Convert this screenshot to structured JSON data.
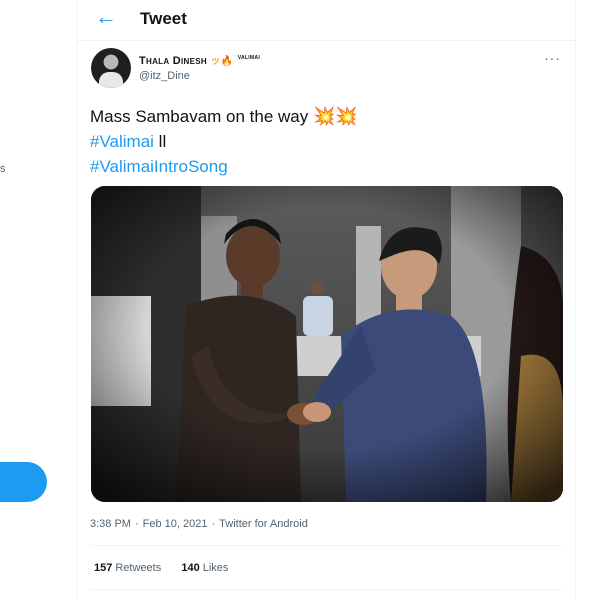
{
  "header": {
    "title": "Tweet"
  },
  "tweet": {
    "display_name": "Thala Dinesh",
    "name_emoji": "ッ🔥",
    "name_suffix": "valimai",
    "handle": "@itz_Dine",
    "more": "···",
    "line1_text": "Mass Sambavam on the way",
    "line1_emoji": "💥💥",
    "hashtag1": "#Valimai",
    "hashtag1_suffix": " ll",
    "hashtag2": "#ValimaiIntroSong",
    "time": "3:38 PM",
    "date": "Feb 10, 2021",
    "source": "Twitter for Android",
    "retweets_count": "157",
    "retweets_label": "Retweets",
    "likes_count": "140",
    "likes_label": "Likes"
  },
  "sidebar": {
    "fragment_text": "s"
  },
  "colors": {
    "accent": "#1d9bf0",
    "text": "#0f1419",
    "muted": "#536471"
  }
}
